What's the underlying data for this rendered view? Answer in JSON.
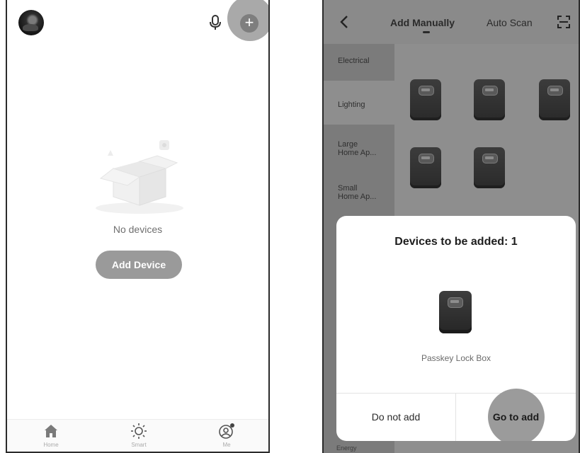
{
  "left_screen": {
    "empty_text": "No devices",
    "add_device_label": "Add Device",
    "nav": [
      {
        "label": "Home",
        "icon": "home-icon"
      },
      {
        "label": "Smart",
        "icon": "sun-icon"
      },
      {
        "label": "Me",
        "icon": "profile-icon"
      }
    ]
  },
  "right_screen": {
    "tabs": {
      "manual": "Add Manually",
      "auto": "Auto Scan"
    },
    "categories": [
      "Electrical",
      "Lighting",
      "Large\nHome Ap...",
      "Small\nHome Ap..."
    ],
    "bottom_peek": "Energy",
    "modal": {
      "title": "Devices to be added: 1",
      "device_name": "Passkey Lock Box",
      "cancel_label": "Do not add",
      "confirm_label": "Go to add"
    }
  }
}
